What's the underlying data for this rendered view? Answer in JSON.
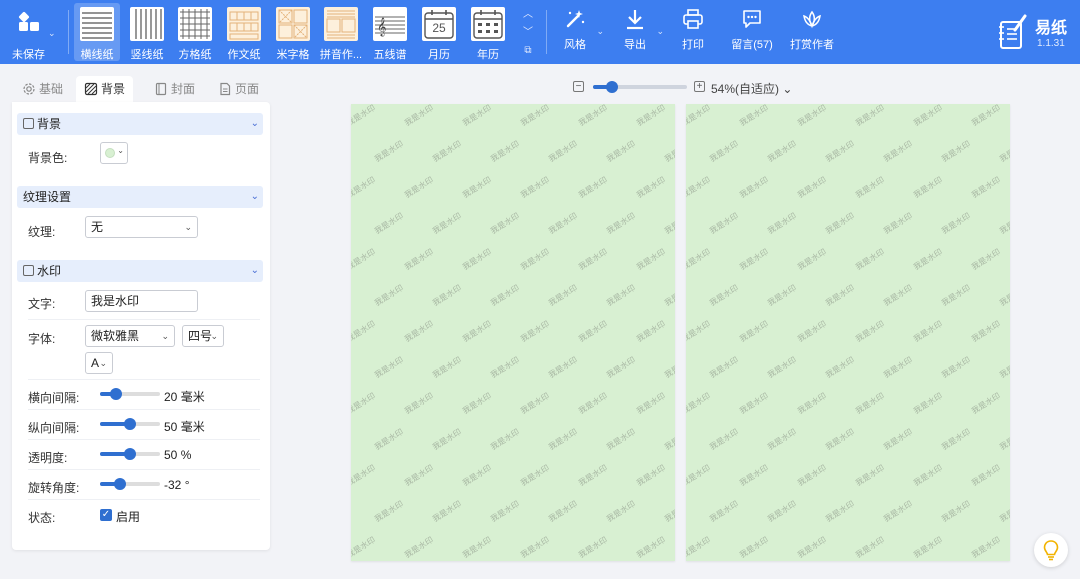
{
  "toolbar": {
    "unsaved_label": "未保存",
    "papers": [
      {
        "key": "horizontal",
        "label": "横线纸",
        "active": true
      },
      {
        "key": "vertical",
        "label": "竖线纸"
      },
      {
        "key": "grid",
        "label": "方格纸"
      },
      {
        "key": "essay",
        "label": "作文纸"
      },
      {
        "key": "mi",
        "label": "米字格"
      },
      {
        "key": "pinyin",
        "label": "拼音作..."
      },
      {
        "key": "staff",
        "label": "五线谱"
      },
      {
        "key": "month",
        "label": "月历",
        "day": "25"
      },
      {
        "key": "year",
        "label": "年历"
      }
    ],
    "tools": {
      "style": "风格",
      "export": "导出",
      "print": "打印",
      "comment": "留言(57)",
      "tip": "打赏作者"
    },
    "brand": {
      "name": "易纸",
      "version": "1.1.31"
    }
  },
  "tabs": [
    {
      "label": "基础",
      "icon": "gear-icon"
    },
    {
      "label": "背景",
      "icon": "texture-icon",
      "active": true
    },
    {
      "label": "封面",
      "icon": "cover-icon"
    },
    {
      "label": "页面",
      "icon": "page-icon"
    }
  ],
  "panel": {
    "background_section": "背景",
    "bg_color_label": "背景色:",
    "texture_section": "纹理设置",
    "texture_label": "纹理:",
    "texture_value": "无",
    "watermark_section": "水印",
    "text_label": "文字:",
    "text_value": "我是水印",
    "font_label": "字体:",
    "font_value": "微软雅黑",
    "font_size_value": "四号",
    "font_style_value": "A",
    "h_spacing_label": "横向间隔:",
    "h_spacing_value": "20",
    "h_spacing_unit": "毫米",
    "v_spacing_label": "纵向间隔:",
    "v_spacing_value": "50",
    "v_spacing_unit": "毫米",
    "opacity_label": "透明度:",
    "opacity_value": "50",
    "opacity_unit": "%",
    "rotation_label": "旋转角度:",
    "rotation_value": "-32",
    "rotation_unit": "°",
    "status_label": "状态:",
    "status_enabled_label": "启用"
  },
  "sliders": {
    "h_spacing_fraction": 0.27,
    "v_spacing_fraction": 0.5,
    "opacity_fraction": 0.5,
    "rotation_fraction": 0.33
  },
  "zoom": {
    "value": "54%(自适应)",
    "fraction": 0.2
  },
  "canvas": {
    "watermark_text": "我是水印",
    "page_color": "#d8f0d2"
  },
  "colors": {
    "accent": "#3d7ef0",
    "slider": "#2f6fd0"
  }
}
